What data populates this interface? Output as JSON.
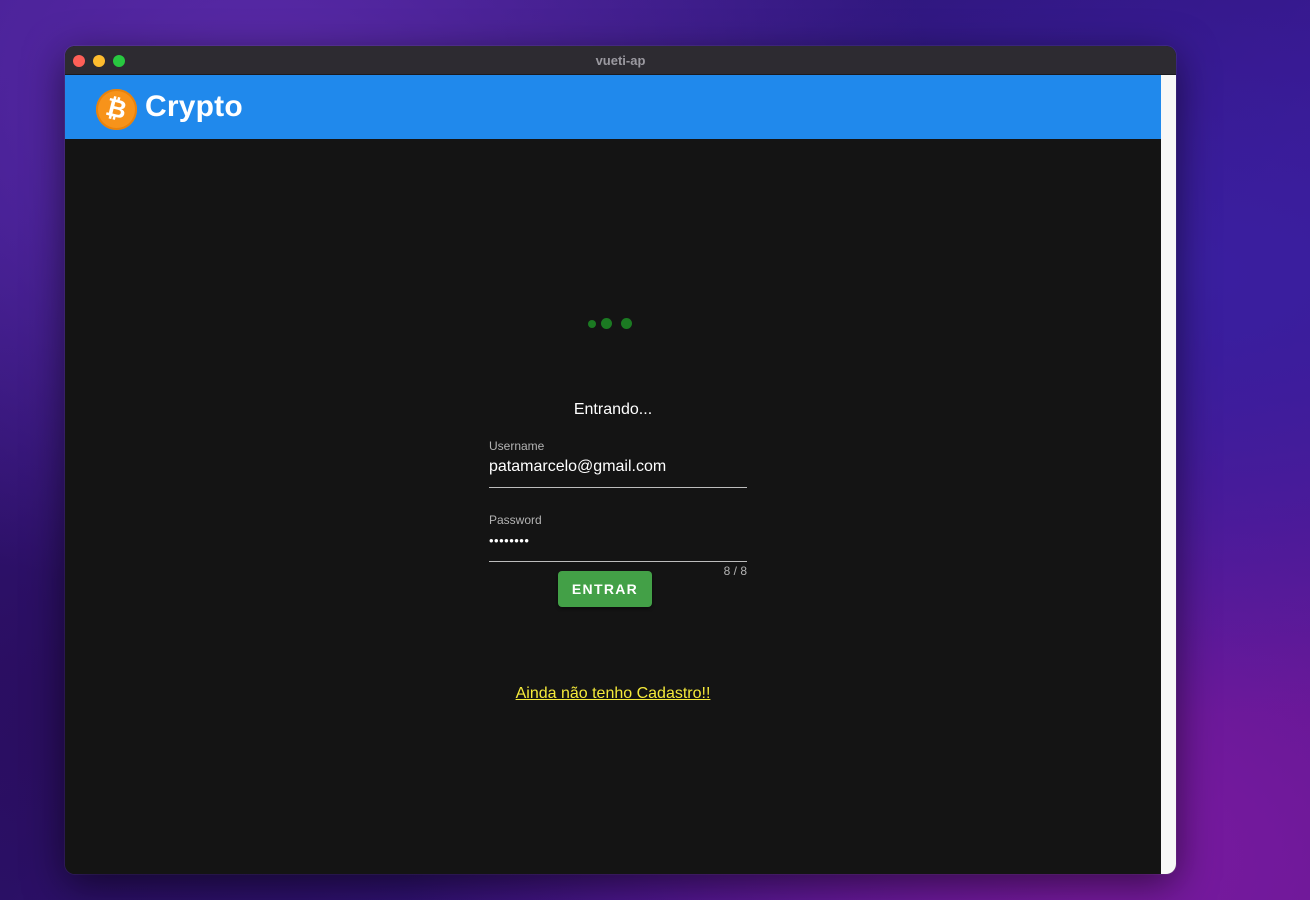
{
  "window": {
    "title": "vueti-ap"
  },
  "appbar": {
    "brand": "Crypto",
    "logo_icon": "bitcoin-icon",
    "logo_glyph": "₿",
    "color": "#2089ec"
  },
  "login": {
    "status_text": "Entrando...",
    "loader_color": "#1b7a22",
    "username": {
      "label": "Username",
      "value": "patamarcelo@gmail.com"
    },
    "password": {
      "label": "Password",
      "value": "••••••••",
      "counter": "8 / 8"
    },
    "submit_label": "ENTRAR",
    "submit_color": "#43a047",
    "register_link": "Ainda não tenho Cadastro!!",
    "register_link_color": "#f5ea3a"
  }
}
